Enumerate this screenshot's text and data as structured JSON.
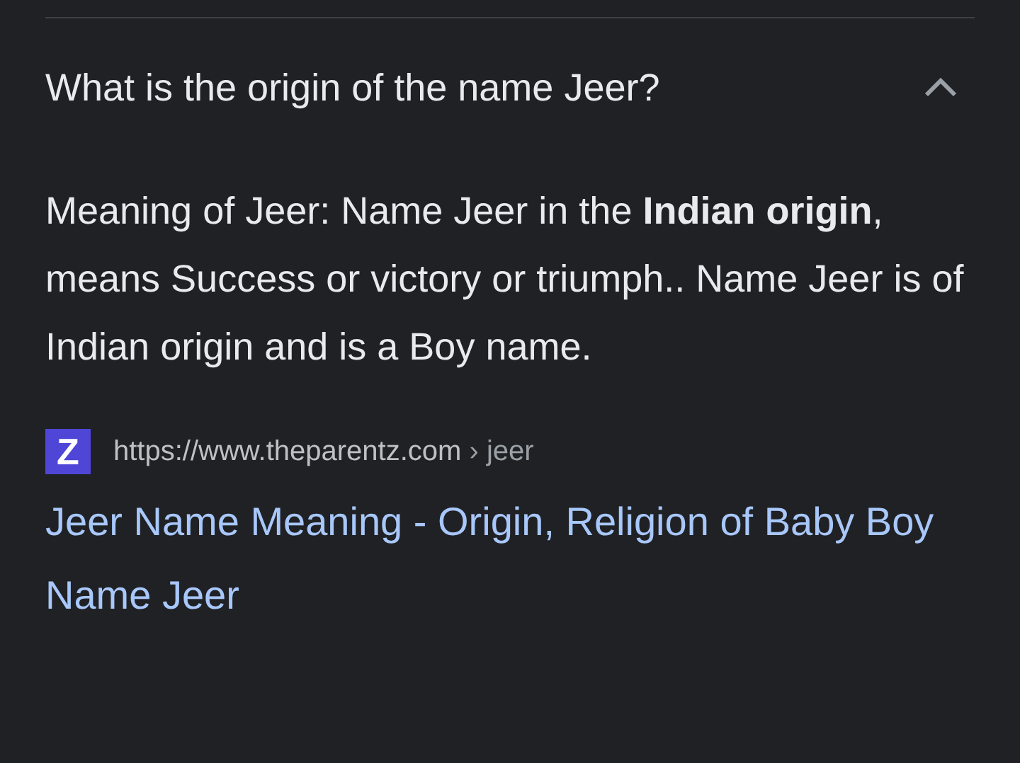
{
  "question": {
    "text": "What is the origin of the name Jeer?",
    "expanded": true
  },
  "answer": "Meaning of Jeer: Name Jeer in the **Indian origin**, means Success or victory or triumph.. Name Jeer is of Indian origin and is a Boy name.",
  "source": {
    "favicon": "Z",
    "url": "https://www.theparentz.com",
    "breadcrumb": "› jeer",
    "title": "Jeer Name Meaning - Origin, Religion of Baby Boy Name Jeer"
  }
}
